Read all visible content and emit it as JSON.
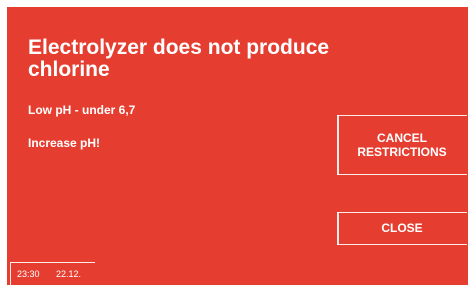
{
  "alarm": {
    "title": "Electrolyzer does not produce chlorine",
    "message_line_1": "Low pH - under 6,7",
    "message_line_2": "Increase pH!"
  },
  "buttons": {
    "cancel_restrictions_label": "CANCEL\nRESTRICTIONS",
    "close_label": "CLOSE"
  },
  "status": {
    "time": "23:30",
    "date": "22.12."
  },
  "colors": {
    "alarm_background": "#e53e30",
    "text": "#ffffff",
    "frame": "#ffffff"
  }
}
